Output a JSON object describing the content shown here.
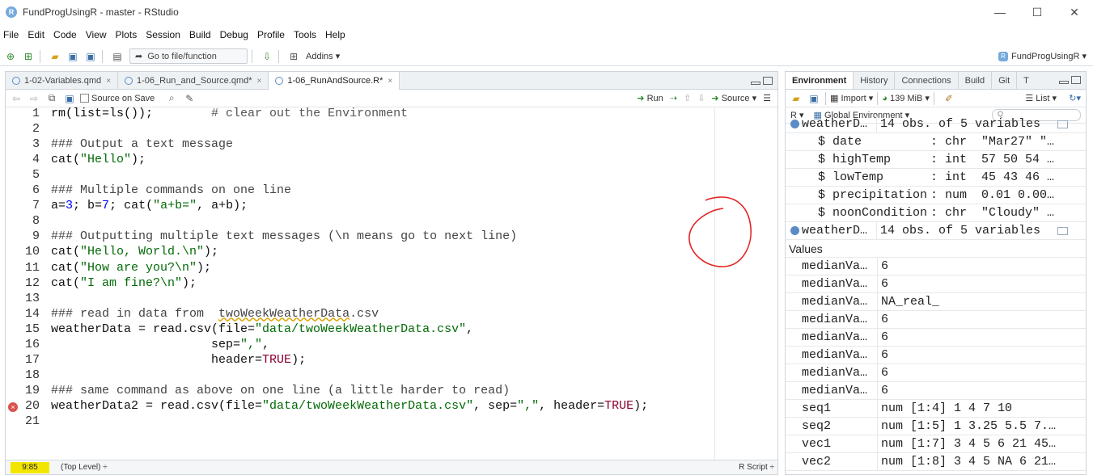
{
  "window": {
    "title": "FundProgUsingR - master - RStudio",
    "app_letter": "R",
    "minimize": "—",
    "maximize": "☐",
    "close": "✕"
  },
  "menu": [
    "File",
    "Edit",
    "Code",
    "View",
    "Plots",
    "Session",
    "Build",
    "Debug",
    "Profile",
    "Tools",
    "Help"
  ],
  "toolbar": {
    "goto_placeholder": "Go to file/function",
    "addins": "Addins",
    "project": "FundProgUsingR"
  },
  "editor": {
    "tabs": [
      {
        "label": "1-02-Variables.qmd",
        "close": "×"
      },
      {
        "label": "1-06_Run_and_Source.qmd*",
        "close": "×"
      },
      {
        "label": "1-06_RunAndSource.R*",
        "close": "×"
      }
    ],
    "source_on_save": "Source on Save",
    "run": "Run",
    "source": "Source",
    "lines": [
      {
        "n": "1",
        "parts": [
          [
            "",
            "rm(list=ls());        "
          ],
          [
            "c-comment",
            "# clear out the Environment"
          ]
        ]
      },
      {
        "n": "2",
        "parts": []
      },
      {
        "n": "3",
        "parts": [
          [
            "c-heading",
            "### Output a text message"
          ]
        ]
      },
      {
        "n": "4",
        "parts": [
          [
            "",
            "cat("
          ],
          [
            "c-str",
            "\"Hello\""
          ],
          [
            "",
            ");"
          ]
        ]
      },
      {
        "n": "5",
        "parts": []
      },
      {
        "n": "6",
        "parts": [
          [
            "c-heading",
            "### Multiple commands on one line"
          ]
        ]
      },
      {
        "n": "7",
        "parts": [
          [
            "",
            "a="
          ],
          [
            "c-num",
            "3"
          ],
          [
            "",
            "; b="
          ],
          [
            "c-num",
            "7"
          ],
          [
            "",
            "; cat("
          ],
          [
            "c-str",
            "\"a+b=\""
          ],
          [
            "",
            ", a+b);"
          ]
        ]
      },
      {
        "n": "8",
        "parts": []
      },
      {
        "n": "9",
        "parts": [
          [
            "c-heading",
            "### Outputting multiple text messages (\\n means go to next line)"
          ]
        ]
      },
      {
        "n": "10",
        "parts": [
          [
            "",
            "cat("
          ],
          [
            "c-str",
            "\"Hello, World.\\n\""
          ],
          [
            "",
            ");"
          ]
        ]
      },
      {
        "n": "11",
        "parts": [
          [
            "",
            "cat("
          ],
          [
            "c-str",
            "\"How are you?\\n\""
          ],
          [
            "",
            ");"
          ]
        ]
      },
      {
        "n": "12",
        "parts": [
          [
            "",
            "cat("
          ],
          [
            "c-str",
            "\"I am fine?\\n\""
          ],
          [
            "",
            ");"
          ]
        ]
      },
      {
        "n": "13",
        "parts": []
      },
      {
        "n": "14",
        "parts": [
          [
            "c-heading",
            "### read in data from  "
          ],
          [
            "c-heading underline-wavy",
            "twoWeekWeatherData"
          ],
          [
            "c-heading",
            ".csv"
          ]
        ]
      },
      {
        "n": "15",
        "parts": [
          [
            "",
            "weatherData = read.csv(file="
          ],
          [
            "c-str",
            "\"data/twoWeekWeatherData.csv\""
          ],
          [
            "",
            ","
          ]
        ]
      },
      {
        "n": "16",
        "parts": [
          [
            "",
            "                      sep="
          ],
          [
            "c-str",
            "\",\""
          ],
          [
            "",
            ","
          ]
        ]
      },
      {
        "n": "17",
        "parts": [
          [
            "",
            "                      header="
          ],
          [
            "c-kw",
            "TRUE"
          ],
          [
            "",
            ");"
          ]
        ]
      },
      {
        "n": "18",
        "parts": []
      },
      {
        "n": "19",
        "parts": [
          [
            "c-heading",
            "### same command as above on one line (a little harder to read)"
          ]
        ]
      },
      {
        "n": "20",
        "parts": [
          [
            "",
            "weatherData2 = read.csv(file="
          ],
          [
            "c-str",
            "\"data/twoWeekWeatherData.csv\""
          ],
          [
            "",
            ", sep="
          ],
          [
            "c-str",
            "\",\""
          ],
          [
            "",
            ", header="
          ],
          [
            "c-kw",
            "TRUE"
          ],
          [
            "",
            ");"
          ]
        ]
      },
      {
        "n": "21",
        "parts": []
      }
    ],
    "error_mark": "×",
    "status": {
      "position": "9:85",
      "scope": "(Top Level) ÷",
      "filetype": "R Script ÷"
    }
  },
  "environment": {
    "tabs": [
      "Environment",
      "History",
      "Connections",
      "Build",
      "Git",
      "T"
    ],
    "import": "Import",
    "memory": "139 MiB",
    "list": "List",
    "r_label": "R",
    "scope": "Global Environment",
    "search_placeholder": "Q",
    "rows": [
      {
        "kind": "obj",
        "name": "weatherD…",
        "val": "14 obs. of 5 variables"
      },
      {
        "kind": "sub",
        "name": "$ date         ",
        "val": ": chr  \"Mar27\" \"…"
      },
      {
        "kind": "sub",
        "name": "$ highTemp     ",
        "val": ": int  57 50 54 …"
      },
      {
        "kind": "sub",
        "name": "$ lowTemp      ",
        "val": ": int  45 43 46 …"
      },
      {
        "kind": "sub",
        "name": "$ precipitation",
        "val": ": num  0.01 0.00…"
      },
      {
        "kind": "sub",
        "name": "$ noonCondition",
        "val": ": chr  \"Cloudy\" …"
      },
      {
        "kind": "obj",
        "name": "weatherD…",
        "val": "14 obs. of 5 variables"
      }
    ],
    "values_header": "Values",
    "values": [
      {
        "name": "medianVa…",
        "val": "6"
      },
      {
        "name": "medianVa…",
        "val": "6"
      },
      {
        "name": "medianVa…",
        "val": "NA_real_"
      },
      {
        "name": "medianVa…",
        "val": "6"
      },
      {
        "name": "medianVa…",
        "val": "6"
      },
      {
        "name": "medianVa…",
        "val": "6"
      },
      {
        "name": "medianVa…",
        "val": "6"
      },
      {
        "name": "medianVa…",
        "val": "6"
      },
      {
        "name": "seq1",
        "val": "num [1:4] 1 4 7 10"
      },
      {
        "name": "seq2",
        "val": "num [1:5] 1 3.25 5.5 7.…"
      },
      {
        "name": "vec1",
        "val": "num [1:7] 3 4 5 6 21 45…"
      },
      {
        "name": "vec2",
        "val": "num [1:8] 3 4 5 NA 6 21…"
      }
    ]
  }
}
